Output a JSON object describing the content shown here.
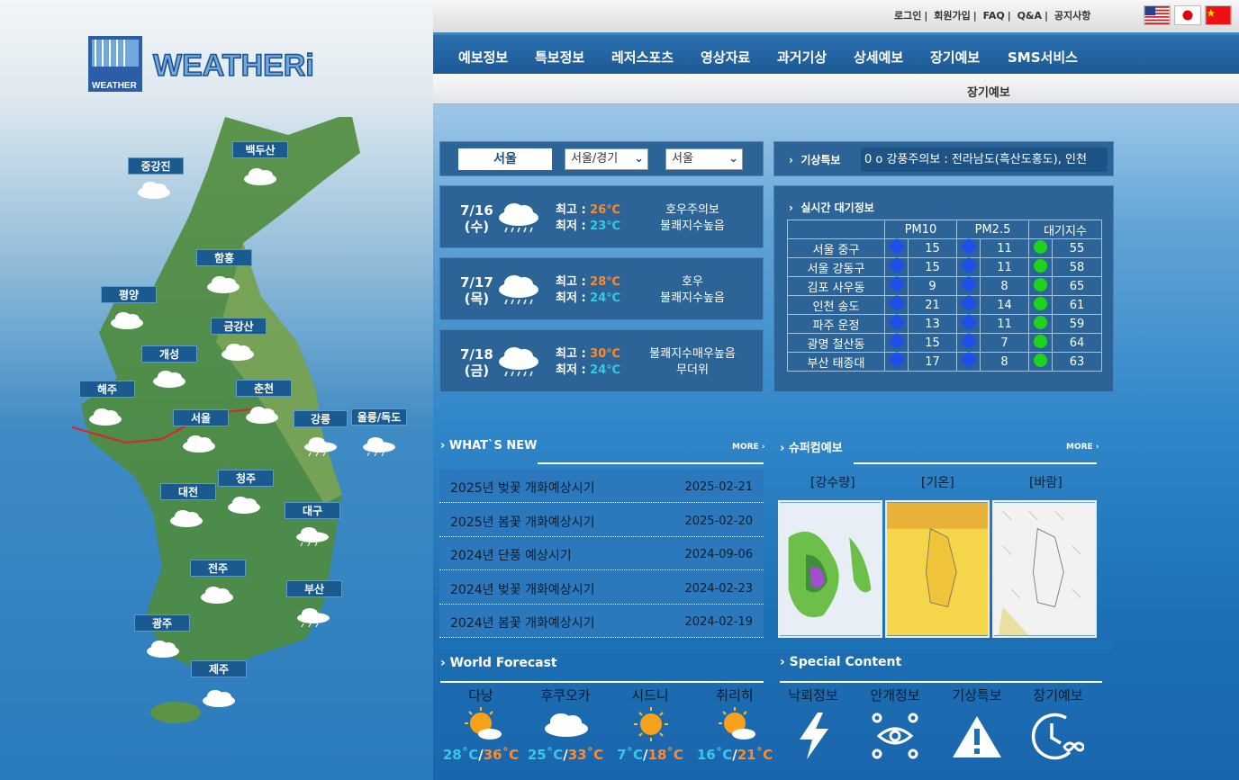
{
  "header": {
    "logo_text": "WEATHERi",
    "top_links": [
      "로그인",
      "회원가입",
      "FAQ",
      "Q&A",
      "공지사항"
    ],
    "flags": [
      "us-flag",
      "japan-flag",
      "china-flag"
    ]
  },
  "nav": {
    "items": [
      "예보정보",
      "특보정보",
      "레저스포츠",
      "영상자료",
      "과거기상",
      "상세예보",
      "장기예보",
      "SMS서비스"
    ],
    "current": "장기예보"
  },
  "map": {
    "cities": [
      "중강진",
      "백두산",
      "함흥",
      "평양",
      "금강산",
      "개성",
      "해주",
      "춘천",
      "서울",
      "강릉",
      "울릉/독도",
      "청주",
      "대전",
      "대구",
      "전주",
      "부산",
      "광주",
      "제주"
    ]
  },
  "location": {
    "city": "서울",
    "region_select": "서울/경기",
    "city_select": "서울"
  },
  "alert": {
    "label": "기상특보",
    "text": "0 o 강풍주의보 : 전라남도(흑산도홍도), 인천"
  },
  "forecast": [
    {
      "date": "7/16",
      "dow": "(수)",
      "hi_label": "최고 : ",
      "hi": "26℃",
      "lo_label": "최저 : ",
      "lo": "23℃",
      "note1": "호우주의보",
      "note2": "불쾌지수높음"
    },
    {
      "date": "7/17",
      "dow": "(목)",
      "hi_label": "최고 : ",
      "hi": "28℃",
      "lo_label": "최저 : ",
      "lo": "24℃",
      "note1": "호우",
      "note2": "불쾌지수높음"
    },
    {
      "date": "7/18",
      "dow": "(금)",
      "hi_label": "최고 : ",
      "hi": "30℃",
      "lo_label": "최저 : ",
      "lo": "24℃",
      "note1": "불쾌지수매우높음",
      "note2": "무더위"
    }
  ],
  "air": {
    "label": "실시간 대기정보",
    "headers": [
      "",
      "PM10",
      "PM2.5",
      "대기지수"
    ],
    "rows": [
      {
        "station": "서울 중구",
        "pm10": "15",
        "pm25": "11",
        "index": "55"
      },
      {
        "station": "서울 강동구",
        "pm10": "15",
        "pm25": "11",
        "index": "58"
      },
      {
        "station": "김포 사우동",
        "pm10": "9",
        "pm25": "8",
        "index": "65"
      },
      {
        "station": "인천 송도",
        "pm10": "21",
        "pm25": "14",
        "index": "61"
      },
      {
        "station": "파주 운정",
        "pm10": "13",
        "pm25": "11",
        "index": "59"
      },
      {
        "station": "광명 철산동",
        "pm10": "15",
        "pm25": "7",
        "index": "64"
      },
      {
        "station": "부산 태종대",
        "pm10": "17",
        "pm25": "8",
        "index": "63"
      }
    ]
  },
  "news": {
    "title": "WHAT`S NEW",
    "more": "MORE",
    "items": [
      {
        "title": "2025년 벚꽃 개화예상시기",
        "date": "2025-02-21"
      },
      {
        "title": "2025년 봄꽃 개화예상시기",
        "date": "2025-02-20"
      },
      {
        "title": "2024년 단풍 예상시기",
        "date": "2024-09-06"
      },
      {
        "title": "2024년 벚꽃 개화예상시기",
        "date": "2024-02-23"
      },
      {
        "title": "2024년 봄꽃 개화예상시기",
        "date": "2024-02-19"
      }
    ]
  },
  "supercomputer": {
    "title": "슈퍼컴예보",
    "more": "MORE",
    "labels": [
      "[강수량]",
      "[기온]",
      "[바람]"
    ]
  },
  "world": {
    "title": "World Forecast",
    "cities": [
      {
        "name": "다낭",
        "lo": "28˚C",
        "hi": "36˚C",
        "icon": "sun-cloud-icon"
      },
      {
        "name": "후쿠오카",
        "lo": "25˚C",
        "hi": "33˚C",
        "icon": "cloud-icon"
      },
      {
        "name": "시드니",
        "lo": "7˚C",
        "hi": "18˚C",
        "icon": "sun-icon"
      },
      {
        "name": "취리히",
        "lo": "16˚C",
        "hi": "21˚C",
        "icon": "sun-cloud-icon"
      }
    ]
  },
  "special": {
    "title": "Special Content",
    "items": [
      "낙뢰정보",
      "안개정보",
      "기상특보",
      "장기예보"
    ]
  }
}
